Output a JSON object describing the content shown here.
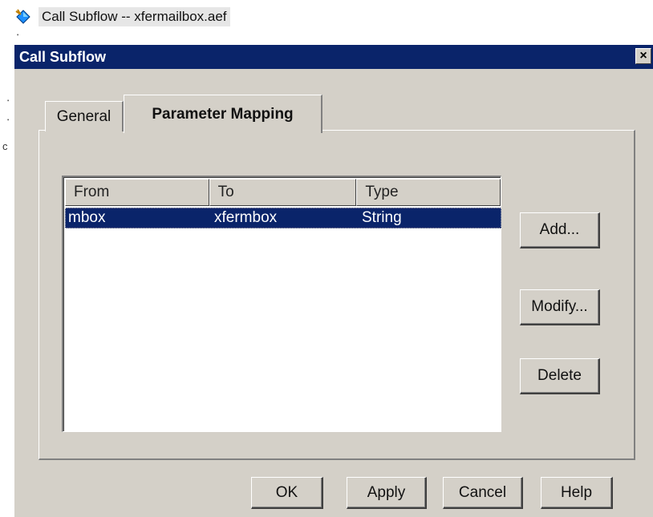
{
  "workflow": {
    "node_label": "Call Subflow -- xfermailbox.aef",
    "node_icon": "step-diamond-icon"
  },
  "dialog": {
    "title": "Call Subflow",
    "close_label": "×",
    "tabs": [
      {
        "label": "General",
        "active": false
      },
      {
        "label": "Parameter Mapping",
        "active": true
      }
    ],
    "mapping_table": {
      "columns": [
        "From",
        "To",
        "Type"
      ],
      "rows": [
        {
          "from": "mbox",
          "to": "xfermbox",
          "type": "String",
          "selected": true
        }
      ]
    },
    "side_buttons": {
      "add": "Add...",
      "modify": "Modify...",
      "delete": "Delete"
    },
    "footer_buttons": {
      "ok": "OK",
      "apply": "Apply",
      "cancel": "Cancel",
      "help": "Help"
    }
  },
  "colors": {
    "titlebar": "#0a246a",
    "selection": "#0a246a",
    "face": "#d4d0c8"
  }
}
